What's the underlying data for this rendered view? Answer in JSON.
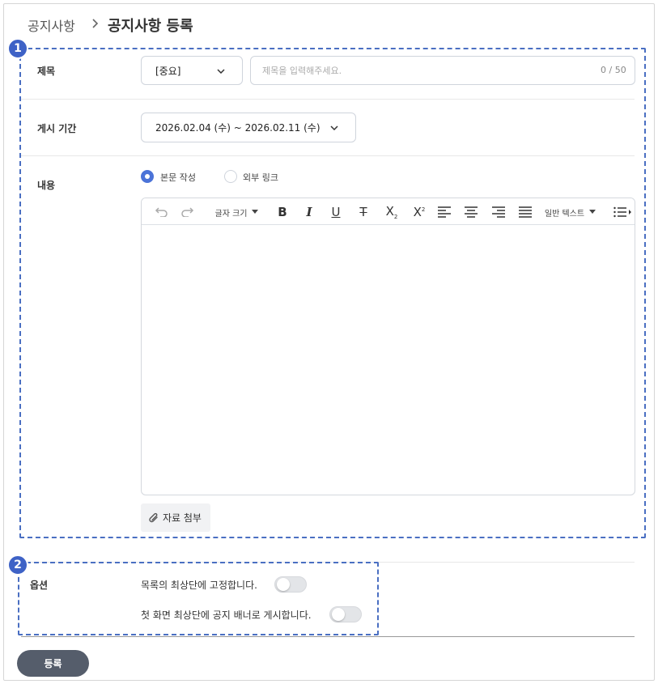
{
  "breadcrumb": {
    "root": "공지사항",
    "current": "공지사항 등록"
  },
  "annotations": {
    "badge_1": "1",
    "badge_2": "2"
  },
  "form": {
    "title": {
      "label": "제목",
      "category_value": "[중요]",
      "placeholder": "제목을 입력해주세요.",
      "counter": "0 / 50"
    },
    "period": {
      "label": "게시 기간",
      "value": "2026.02.04 (수) ~ 2026.02.11 (수)"
    },
    "content": {
      "label": "내용",
      "radio_options": [
        {
          "label": "본문 작성",
          "selected": true
        },
        {
          "label": "외부 링크",
          "selected": false
        }
      ],
      "toolbar": {
        "font_size_label": "글자 크기",
        "text_style_label": "일반 텍스트"
      },
      "attach_label": "자료 첨부"
    },
    "options": {
      "label": "옵션",
      "items": [
        {
          "label": "목록의 최상단에 고정합니다.",
          "on": false
        },
        {
          "label": "첫 화면 최상단에 공지 배너로 게시합니다.",
          "on": false
        }
      ]
    },
    "submit_label": "등록"
  },
  "colors": {
    "accent": "#4b73d8",
    "annotation": "#3e62c6",
    "submit": "#555d6b"
  },
  "icons": [
    "chevron-right-icon",
    "chevron-down-icon",
    "undo-icon",
    "redo-icon",
    "bold-icon",
    "italic-icon",
    "underline-icon",
    "strikethrough-icon",
    "subscript-icon",
    "superscript-icon",
    "align-left-icon",
    "align-center-icon",
    "align-right-icon",
    "align-justify-icon",
    "list-icon",
    "paperclip-icon"
  ]
}
